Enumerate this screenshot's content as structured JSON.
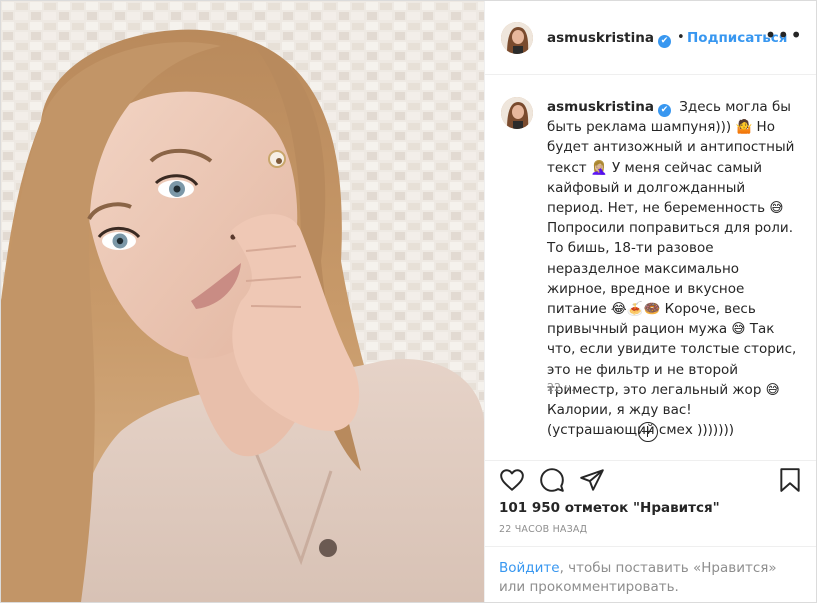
{
  "header": {
    "username": "asmuskristina",
    "verified_mark": "✔",
    "separator": "•",
    "follow_label": "Подписаться",
    "more_icon": "more-options-icon"
  },
  "caption": {
    "username": "asmuskristina",
    "text": "Здесь могла бы быть реклама шампуня))) 🤷 Но будет антизожный и антипостный текст 🤦🏼‍♀️ У меня сейчас самый кайфовый и долгожданный период. Нет, не беременность 😅 Попросили поправиться для роли. То бишь, 18-ти разовое неразделное максимально жирное, вредное и вкусное питание 😂🍝🍩 Короче, весь привычный рацион мужа 😅 Так что, если увидите толстые сторис, это не фильтр и не второй триместр, это легальный жор 😅 Калории, я жду вас! (устрашающий смех )))))))",
    "time": "22 ч."
  },
  "actions": {
    "icons": [
      "heart-icon",
      "comment-icon",
      "share-icon",
      "bookmark-icon"
    ],
    "likes": "101 950 отметок \"Нравится\"",
    "ago": "22 ЧАСОВ НАЗАД"
  },
  "login": {
    "link": "Войдите",
    "rest": ", чтобы поставить «Нравится» или прокомментировать."
  },
  "colors": {
    "accent": "#3897f0",
    "text": "#262626",
    "muted": "#8e8e8e",
    "border": "#efefef"
  }
}
